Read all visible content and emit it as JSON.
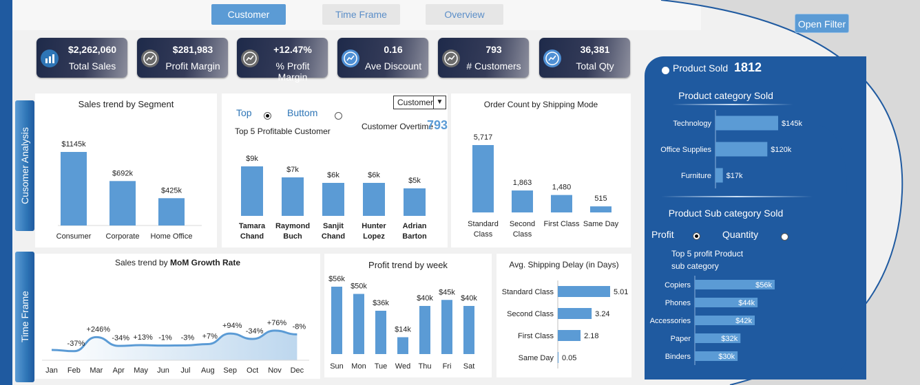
{
  "nav": {
    "tabs": [
      "Customer",
      "Time Frame",
      "Overview"
    ],
    "active": 0,
    "open_filter": "Open Filter"
  },
  "kpis": [
    {
      "value": "$2,262,060",
      "label": "Total Sales",
      "icon": "bar-chart-icon"
    },
    {
      "value": "$281,983",
      "label": "Profit Margin",
      "icon": "trend-icon"
    },
    {
      "value": "+12.47%",
      "label": "% Profit Margin",
      "icon": "trend-icon"
    },
    {
      "value": "0.16",
      "label": "Ave Discount",
      "icon": "trend-icon"
    },
    {
      "value": "793",
      "label": "# Customers",
      "icon": "trend-icon"
    },
    {
      "value": "36,381",
      "label": "Total Qty",
      "icon": "trend-icon"
    }
  ],
  "sections": {
    "customer": "Cusomer Analysis",
    "time": "Time Frame"
  },
  "top5": {
    "top_label": "Top",
    "bottom_label": "Buttom",
    "subtitle": "Top 5 Profitable Customer",
    "dropdown": "Customer",
    "overtime_label": "Customer Overtime",
    "overtime_value": "793"
  },
  "right": {
    "product_sold_label": "Product  Sold",
    "product_sold_value": "1812",
    "category_title": "Product category Sold",
    "subcategory_title": "Product Sub category Sold",
    "profit_label": "Profit",
    "quantity_label": "Quantity",
    "top5_title_line1": "Top 5 profit Product",
    "top5_title_line2": "sub category"
  },
  "chart_data": [
    {
      "id": "segment",
      "type": "bar",
      "title": "Sales trend by Segment",
      "categories": [
        "Consumer",
        "Corporate",
        "Home Office"
      ],
      "values": [
        1145,
        692,
        425
      ],
      "labels": [
        "$1145k",
        "$692k",
        "$425k"
      ]
    },
    {
      "id": "customers",
      "type": "bar",
      "title": "",
      "categories": [
        [
          "Tamara",
          "Chand"
        ],
        [
          "Raymond",
          "Buch"
        ],
        [
          "Sanjit",
          "Chand"
        ],
        [
          "Hunter",
          "Lopez"
        ],
        [
          "Adrian",
          "Barton"
        ]
      ],
      "values": [
        9,
        7,
        6,
        6,
        5
      ],
      "labels": [
        "$9k",
        "$7k",
        "$6k",
        "$6k",
        "$5k"
      ]
    },
    {
      "id": "shipmode",
      "type": "bar",
      "title": "Order Count by Shipping Mode",
      "categories": [
        [
          "Standard",
          "Class"
        ],
        [
          "Second",
          "Class"
        ],
        [
          "First Class"
        ],
        [
          "Same Day"
        ]
      ],
      "values": [
        5717,
        1863,
        1480,
        515
      ],
      "labels": [
        "5,717",
        "1,863",
        "1,480",
        "515"
      ]
    },
    {
      "id": "mom",
      "type": "area",
      "title_prefix": "Sales trend by ",
      "title_bold": "MoM Growth Rate",
      "categories": [
        "Jan",
        "Feb",
        "Mar",
        "Apr",
        "May",
        "Jun",
        "Jul",
        "Aug",
        "Sep",
        "Oct",
        "Nov",
        "Dec"
      ],
      "values": [
        null,
        -37,
        246,
        -34,
        13,
        -1,
        -3,
        7,
        94,
        -34,
        76,
        -8
      ],
      "labels": [
        "",
        "-37%",
        "+246%",
        "-34%",
        "+13%",
        "-1%",
        "-3%",
        "+7%",
        "+94%",
        "-34%",
        "+76%",
        "-8%"
      ]
    },
    {
      "id": "week",
      "type": "bar",
      "title": "Profit trend by week",
      "categories": [
        "Sun",
        "Mon",
        "Tue",
        "Wed",
        "Thu",
        "Fri",
        "Sat"
      ],
      "values": [
        56,
        50,
        36,
        14,
        40,
        45,
        40
      ],
      "labels": [
        "$56k",
        "$50k",
        "$36k",
        "$14k",
        "$40k",
        "$45k",
        "$40k"
      ]
    },
    {
      "id": "delay",
      "type": "bar",
      "orientation": "horizontal",
      "title": "Avg. Shipping Delay (in Days)",
      "categories": [
        "Standard Class",
        "Second Class",
        "First Class",
        "Same Day"
      ],
      "values": [
        5.01,
        3.24,
        2.18,
        0.05
      ],
      "labels": [
        "5.01",
        "3.24",
        "2.18",
        "0.05"
      ]
    },
    {
      "id": "category",
      "type": "bar",
      "orientation": "horizontal",
      "title": "Product category Sold",
      "categories": [
        "Technology",
        "Office Supplies",
        "Furniture"
      ],
      "values": [
        145,
        120,
        17
      ],
      "labels": [
        "$145k",
        "$120k",
        "$17k"
      ]
    },
    {
      "id": "subcategory",
      "type": "bar",
      "orientation": "horizontal",
      "title": "Top 5 profit Product sub category",
      "categories": [
        "Copiers",
        "Phones",
        "Accessories",
        "Paper",
        "Binders"
      ],
      "values": [
        56,
        44,
        42,
        32,
        30
      ],
      "labels": [
        "$56k",
        "$44k",
        "$42k",
        "$32k",
        "$30k"
      ]
    }
  ],
  "colors": {
    "bar": "#5b9bd5",
    "dark_blue": "#1f5aa0",
    "accent": "#2e75b6"
  }
}
